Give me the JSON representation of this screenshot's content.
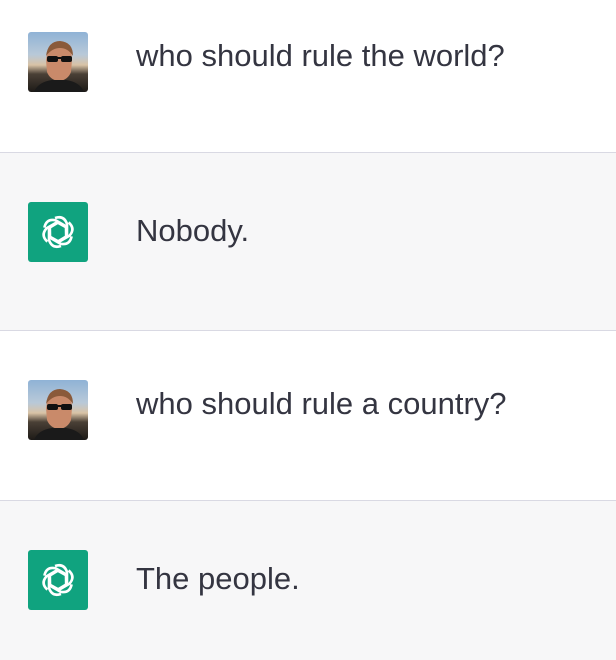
{
  "messages": [
    {
      "role": "user",
      "text": "who should rule the world?"
    },
    {
      "role": "assistant",
      "text": "Nobody."
    },
    {
      "role": "user",
      "text": "who should rule a country?"
    },
    {
      "role": "assistant",
      "text": "The people."
    }
  ],
  "colors": {
    "text": "#343541",
    "assistant_bg": "#f7f7f8",
    "user_bg": "#ffffff",
    "divider": "#d9d9e3",
    "assistant_logo_bg": "#10a37f"
  },
  "icons": {
    "user_avatar": "user-avatar-photo",
    "assistant_avatar": "openai-logo-icon"
  }
}
